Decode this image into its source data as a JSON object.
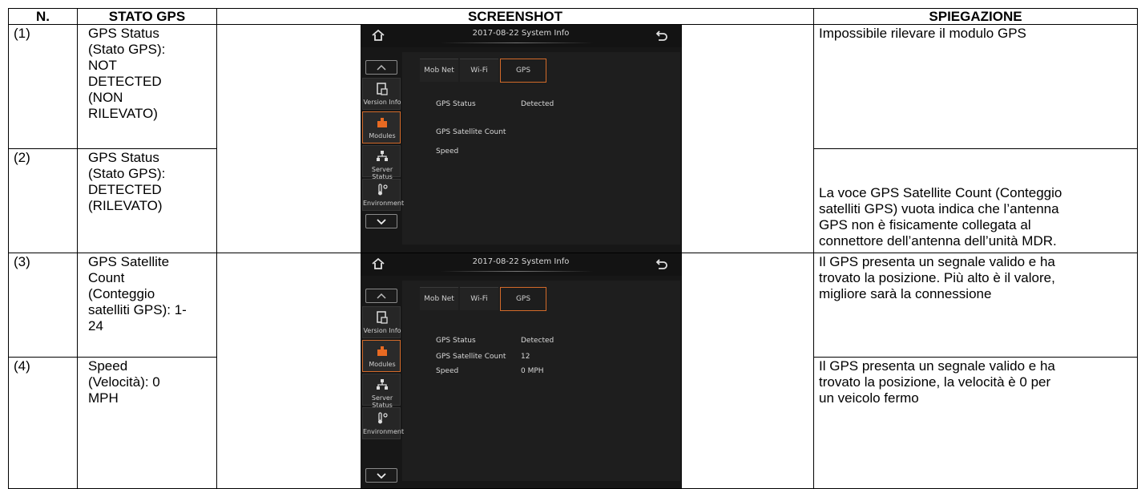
{
  "headers": {
    "num": "N.",
    "state": "STATO GPS",
    "screenshot": "SCREENSHOT",
    "explanation": "SPIEGAZIONE"
  },
  "rows": [
    {
      "num": "(1)",
      "state": "GPS Status\n(Stato GPS):\nNOT\nDETECTED\n(NON\nRILEVATO)",
      "explanation": "Impossibile rilevare il modulo GPS"
    },
    {
      "num": "(2)",
      "state": "GPS Status\n(Stato GPS):\nDETECTED\n(RILEVATO)",
      "explanation": "La voce GPS Satellite Count (Conteggio\nsatelliti GPS) vuota indica che l’antenna\nGPS non è fisicamente collegata al\nconnettore dell’antenna dell’unità MDR."
    },
    {
      "num": "(3)",
      "state": "GPS Satellite\nCount\n(Conteggio\nsatelliti GPS): 1-\n24",
      "explanation": "Il GPS presenta un segnale valido e ha\ntrovato la posizione. Più alto è il valore,\nmigliore sarà la connessione"
    },
    {
      "num": "(4)",
      "state": "Speed\n(Velocità): 0\nMPH",
      "explanation": "Il GPS presenta un segnale valido e ha\ntrovato la posizione, la velocità è 0 per\nun veicolo fermo"
    }
  ],
  "screens": [
    {
      "title": "2017-08-22  System Info",
      "tabs": [
        "Mob Net",
        "Wi-Fi",
        "GPS"
      ],
      "active_tab": "GPS",
      "sidebar": [
        "Version Info",
        "Modules",
        "Server Status",
        "Environment"
      ],
      "active_sidebar": "Modules",
      "fields": [
        {
          "label": "GPS Status",
          "value": "Detected"
        },
        {
          "label": "GPS Satellite Count",
          "value": ""
        },
        {
          "label": "Speed",
          "value": ""
        }
      ]
    },
    {
      "title": "2017-08-22  System Info",
      "tabs": [
        "Mob Net",
        "Wi-Fi",
        "GPS"
      ],
      "active_tab": "GPS",
      "sidebar": [
        "Version Info",
        "Modules",
        "Server Status",
        "Environment"
      ],
      "active_sidebar": "Modules",
      "fields": [
        {
          "label": "GPS Status",
          "value": "Detected"
        },
        {
          "label": "GPS Satellite Count",
          "value": "12"
        },
        {
          "label": "Speed",
          "value": "0 MPH"
        }
      ]
    }
  ],
  "colors": {
    "accent": "#d26a2a",
    "screen_bg": "#171717"
  }
}
